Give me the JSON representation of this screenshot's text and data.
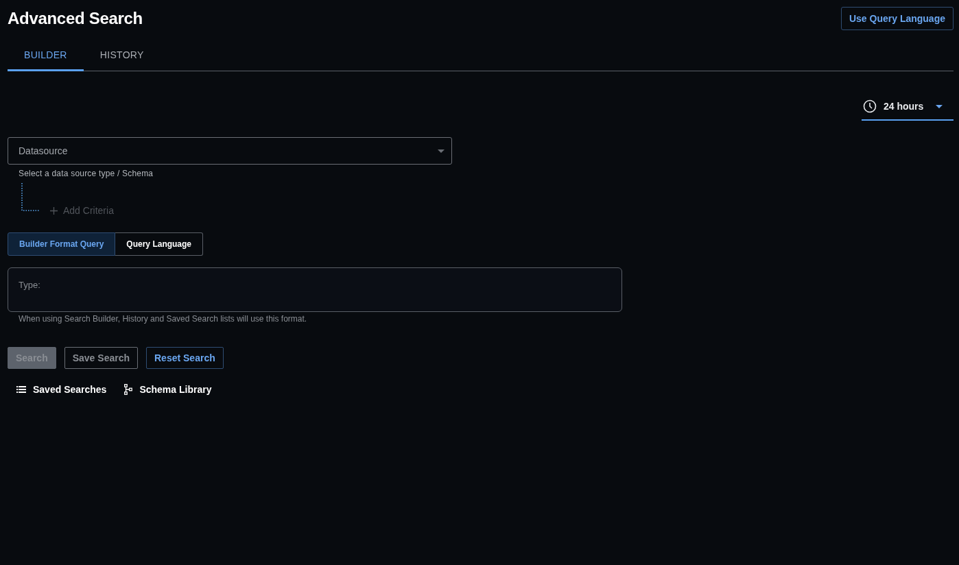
{
  "header": {
    "title": "Advanced Search",
    "action": "Use Query Language"
  },
  "tabs": [
    {
      "label": "BUILDER",
      "selected": true
    },
    {
      "label": "HISTORY",
      "selected": false
    }
  ],
  "time_range": {
    "value": "24 hours"
  },
  "datasource": {
    "placeholder": "Datasource",
    "helper": "Select a data source type / Schema"
  },
  "add_criteria": {
    "label": "Add Criteria",
    "disabled": true
  },
  "format_toggle": [
    {
      "label": "Builder Format Query",
      "selected": true
    },
    {
      "label": "Query Language",
      "selected": false
    }
  ],
  "query": {
    "placeholder": "Type:",
    "hint": "When using Search Builder, History and Saved Search lists will use this format."
  },
  "actions": [
    {
      "label": "Search",
      "kind": "filled",
      "disabled": true
    },
    {
      "label": "Save Search",
      "kind": "outline",
      "disabled": true
    },
    {
      "label": "Reset Search",
      "kind": "accent",
      "disabled": false
    }
  ],
  "links": [
    {
      "label": "Saved Searches",
      "kind": "list"
    },
    {
      "label": "Schema Library",
      "kind": "schema"
    }
  ]
}
